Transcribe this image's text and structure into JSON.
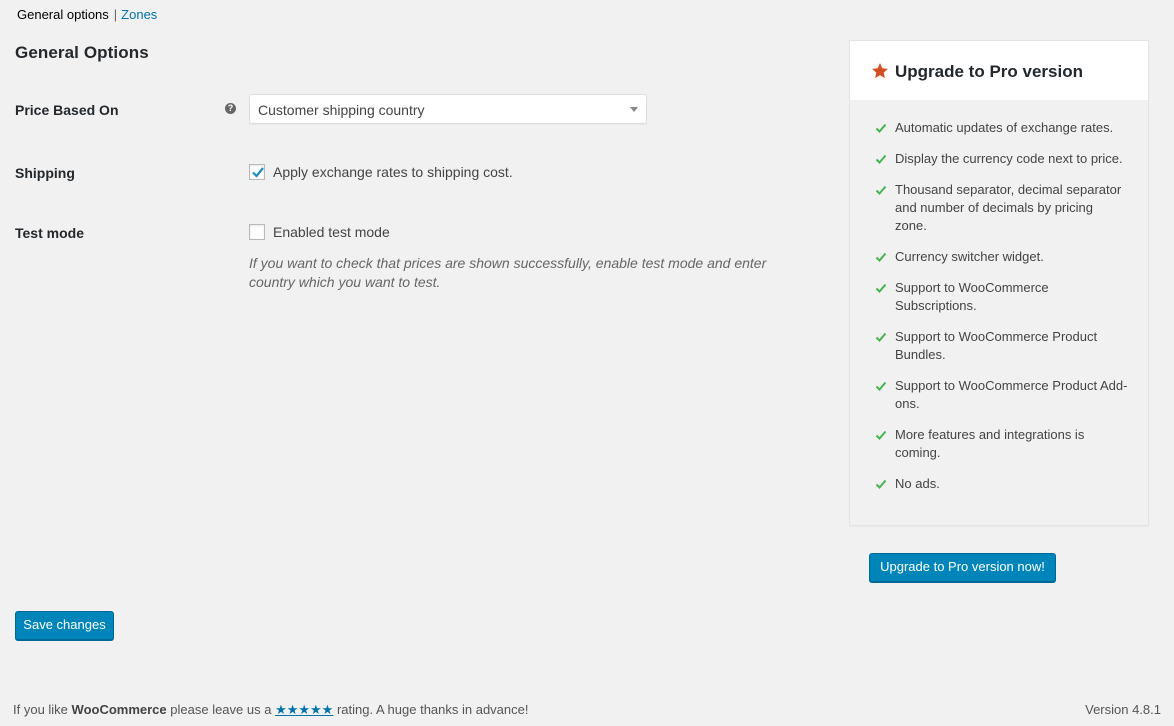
{
  "nav": {
    "general_options": "General options",
    "separator": "|",
    "zones": "Zones"
  },
  "page_title": "General Options",
  "fields": {
    "price_based_on": {
      "label": "Price Based On",
      "help_icon": "question-icon",
      "selected": "Customer shipping country"
    },
    "shipping": {
      "label": "Shipping",
      "checkbox_label": "Apply exchange rates to shipping cost.",
      "checked": true
    },
    "test_mode": {
      "label": "Test mode",
      "checkbox_label": "Enabled test mode",
      "checked": false,
      "description": "If you want to check that prices are shown successfully, enable test mode and enter country which you want to test."
    }
  },
  "save_button": "Save changes",
  "pro": {
    "title": "Upgrade to Pro version",
    "star_color": "#d54e21",
    "check_color": "#46b450",
    "features": [
      "Automatic updates of exchange rates.",
      "Display the currency code next to price.",
      "Thousand separator, decimal separator and number of decimals by pricing zone.",
      "Currency switcher widget.",
      "Support to WooCommerce Subscriptions.",
      "Support to WooCommerce Product Bundles.",
      "Support to WooCommerce Product Add-ons.",
      "More features and integrations is coming.",
      "No ads."
    ],
    "button": "Upgrade to Pro version now!"
  },
  "footer": {
    "prefix": "If you like ",
    "brand": "WooCommerce",
    "middle": " please leave us a ",
    "stars": "★★★★★",
    "suffix": " rating. A huge thanks in advance!",
    "version": "Version 4.8.1"
  }
}
